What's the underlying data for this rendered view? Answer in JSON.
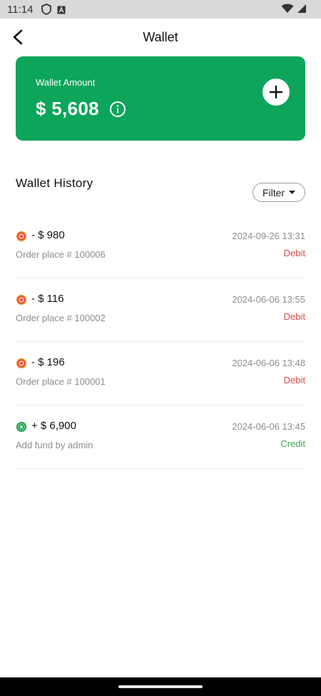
{
  "status_bar": {
    "time": "11:14",
    "icons": [
      "shield-icon",
      "a-badge-icon",
      "wifi-icon",
      "signal-icon"
    ]
  },
  "app_bar": {
    "title": "Wallet",
    "back_icon": "chevron-left-icon"
  },
  "wallet_card": {
    "label": "Wallet Amount",
    "amount": "$ 5,608",
    "background_color": "#0CA55A",
    "info_icon": "info-icon",
    "add_icon": "plus-icon"
  },
  "history": {
    "title": "Wallet History",
    "filter_label": "Filter",
    "filter_icon": "caret-down-icon",
    "transactions": [
      {
        "amount": "- $ 980",
        "description": "Order place # 100006",
        "date": "2024-09-26 13:31",
        "type": "Debit",
        "icon": "debit-coin-icon",
        "type_color": "#E04848"
      },
      {
        "amount": "- $ 116",
        "description": "Order place # 100002",
        "date": "2024-06-06 13:55",
        "type": "Debit",
        "icon": "debit-coin-icon",
        "type_color": "#E04848"
      },
      {
        "amount": "- $ 196",
        "description": "Order place # 100001",
        "date": "2024-06-06 13:48",
        "type": "Debit",
        "icon": "debit-coin-icon",
        "type_color": "#E04848"
      },
      {
        "amount": "+ $ 6,900",
        "description": "Add fund by admin",
        "date": "2024-06-06 13:45",
        "type": "Credit",
        "icon": "credit-coin-icon",
        "type_color": "#3AA84A"
      }
    ]
  }
}
